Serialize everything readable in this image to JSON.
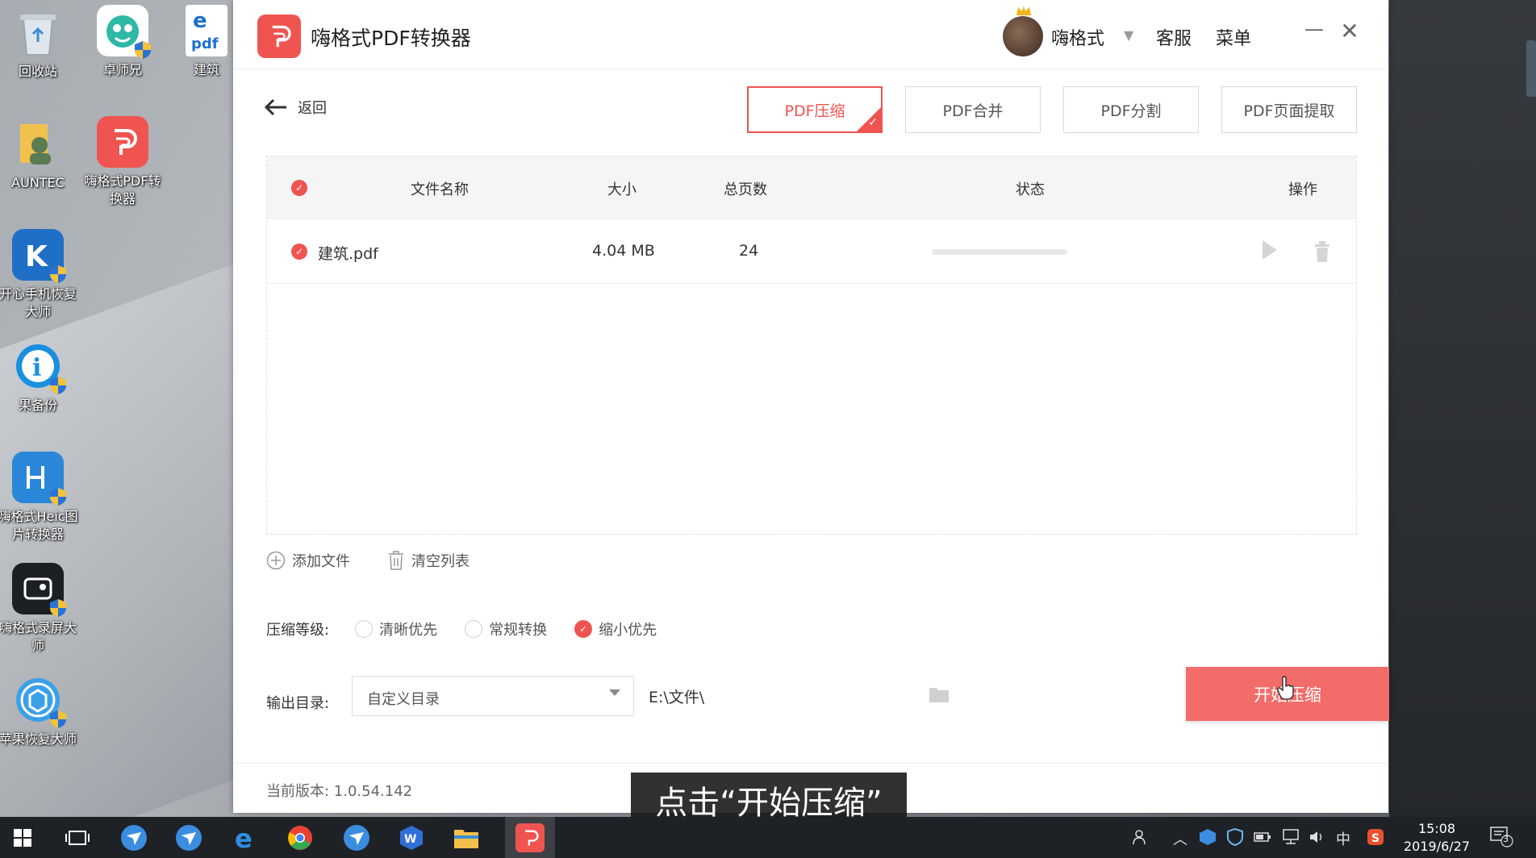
{
  "desktop": {
    "icons": [
      {
        "label": "回收站"
      },
      {
        "label": "卓师兄"
      },
      {
        "label": "建筑"
      },
      {
        "label": "AUNTEC"
      },
      {
        "label": "嗨格式PDF转换器"
      },
      {
        "label": "开心手机恢复大师"
      },
      {
        "label": "果备份"
      },
      {
        "label": "嗨格式Heic图片转换器"
      },
      {
        "label": "嗨格式录屏大师"
      },
      {
        "label": "苹果恢复大师"
      }
    ]
  },
  "app": {
    "title": "嗨格式PDF转换器",
    "user_name": "嗨格式",
    "kefu": "客服",
    "menu": "菜单",
    "back_label": "返回",
    "tabs": [
      {
        "label": "PDF压缩",
        "active": true
      },
      {
        "label": "PDF合并",
        "active": false
      },
      {
        "label": "PDF分割",
        "active": false
      },
      {
        "label": "PDF页面提取",
        "active": false
      }
    ],
    "table": {
      "headers": {
        "name": "文件名称",
        "size": "大小",
        "pages": "总页数",
        "status": "状态",
        "ops": "操作"
      },
      "rows": [
        {
          "name": "建筑.pdf",
          "size": "4.04 MB",
          "pages": "24",
          "progress": 0
        }
      ]
    },
    "actions": {
      "add": "添加文件",
      "clear": "清空列表"
    },
    "compression": {
      "label": "压缩等级:",
      "options": [
        {
          "label": "清晰优先",
          "selected": false
        },
        {
          "label": "常规转换",
          "selected": false
        },
        {
          "label": "缩小优先",
          "selected": true
        }
      ]
    },
    "output": {
      "label": "输出目录:",
      "select_value": "自定义目录",
      "path": "E:\\文件\\"
    },
    "start_button": "开始压缩",
    "version": "当前版本: 1.0.54.142",
    "accent_color": "#ef5450"
  },
  "subtitle": "点击“开始压缩”",
  "taskbar": {
    "tray_lang": "中",
    "time": "15:08",
    "date": "2019/6/27",
    "notification_count": "3"
  }
}
